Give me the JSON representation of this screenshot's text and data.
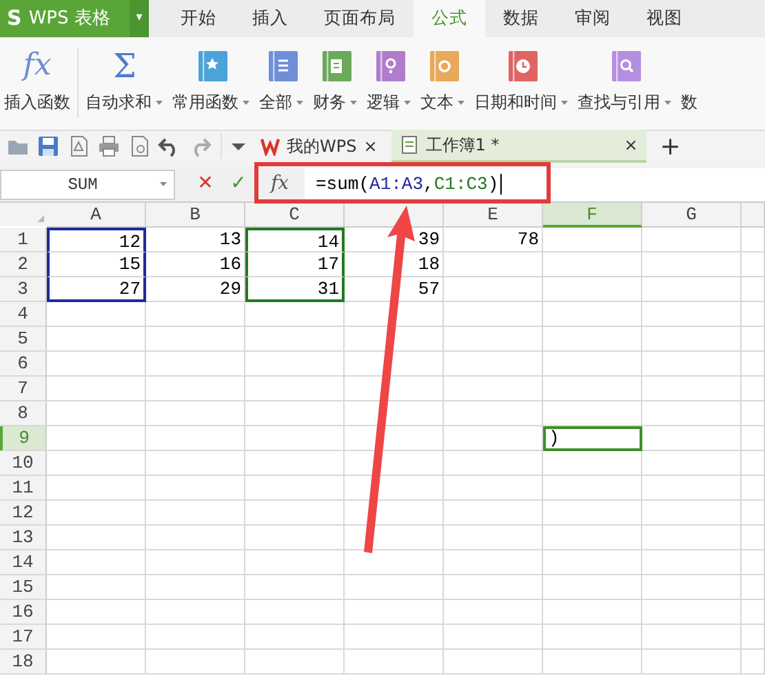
{
  "app": {
    "logo": "S",
    "title": "WPS 表格",
    "menu_caret": "▾"
  },
  "menu_tabs": [
    {
      "label": "开始",
      "selected": false
    },
    {
      "label": "插入",
      "selected": false
    },
    {
      "label": "页面布局",
      "selected": false
    },
    {
      "label": "公式",
      "selected": true
    },
    {
      "label": "数据",
      "selected": false
    },
    {
      "label": "审阅",
      "selected": false
    },
    {
      "label": "视图",
      "selected": false
    }
  ],
  "ribbon": [
    {
      "label": "插入函数",
      "kind": "glyph",
      "glyph": "fx",
      "dropdown": false
    },
    {
      "label": "自动求和",
      "kind": "glyph",
      "glyph": "Σ",
      "dropdown": true
    },
    {
      "label": "常用函数",
      "kind": "star",
      "color": "#4aa3d9",
      "dropdown": true
    },
    {
      "label": "全部",
      "kind": "lines",
      "color": "#6e8fd8",
      "dropdown": true
    },
    {
      "label": "财务",
      "kind": "doc",
      "color": "#6aaa5a",
      "dropdown": true
    },
    {
      "label": "逻辑",
      "kind": "dot",
      "color": "#b07ccc",
      "dropdown": true
    },
    {
      "label": "文本",
      "kind": "ring",
      "color": "#e9a85a",
      "dropdown": true
    },
    {
      "label": "日期和时间",
      "kind": "clock",
      "color": "#e06464",
      "dropdown": true
    },
    {
      "label": "查找与引用",
      "kind": "search",
      "color": "#b48ee0",
      "dropdown": true
    },
    {
      "label": "数",
      "kind": "text",
      "dropdown": false
    }
  ],
  "doc_tabs": [
    {
      "label": "我的WPS",
      "kind": "home",
      "close": "×",
      "selected": false
    },
    {
      "label": "工作簿1 *",
      "kind": "sheet",
      "close": "×",
      "selected": true
    }
  ],
  "new_tab": "+",
  "formula_bar": {
    "name_box": "SUM",
    "cancel": "✕",
    "confirm": "✓",
    "fx": "fx",
    "formula": [
      {
        "text": "=sum(",
        "color": "#000000"
      },
      {
        "text": "A1:A3",
        "color": "#1f2a9c"
      },
      {
        "text": ",",
        "color": "#000000"
      },
      {
        "text": "C1:C3",
        "color": "#217a21"
      },
      {
        "text": ")",
        "color": "#000000"
      }
    ]
  },
  "sheet": {
    "columns": [
      {
        "header": "A",
        "selected": false
      },
      {
        "header": "B",
        "selected": false
      },
      {
        "header": "C",
        "selected": false
      },
      {
        "selected": false
      },
      {
        "header": "E",
        "selected": false
      },
      {
        "header": "F",
        "selected": true
      },
      {
        "header": "G",
        "selected": false
      }
    ],
    "rows": [
      {
        "number": "1",
        "selected": false,
        "cells": [
          {
            "value": "12",
            "color": "#1f2a9c"
          },
          {
            "value": "13"
          },
          {
            "value": "14",
            "color": "#217a21"
          },
          {
            "value": "39"
          },
          {
            "value": "78"
          }
        ]
      },
      {
        "number": "2",
        "selected": false,
        "cells": [
          {
            "value": "15",
            "color": "#1f2a9c"
          },
          {
            "value": "16"
          },
          {
            "value": "17",
            "color": "#217a21"
          },
          {
            "value": "18"
          }
        ]
      },
      {
        "number": "3",
        "selected": false,
        "cells": [
          {
            "value": "27",
            "color": "#1f2a9c"
          },
          {
            "value": "29"
          },
          {
            "value": "31",
            "color": "#217a21"
          },
          {
            "value": "57"
          }
        ]
      },
      {
        "number": "4",
        "selected": false,
        "cells": []
      },
      {
        "number": "5",
        "selected": false,
        "cells": []
      },
      {
        "number": "6",
        "selected": false,
        "cells": []
      },
      {
        "number": "7",
        "selected": false,
        "cells": []
      },
      {
        "number": "8",
        "selected": false,
        "cells": []
      },
      {
        "number": "9",
        "selected": true,
        "cells": [
          null,
          null,
          null,
          null,
          null,
          {
            "value": ")",
            "active": true
          }
        ]
      },
      {
        "number": "10",
        "selected": false,
        "cells": []
      },
      {
        "number": "11",
        "selected": false,
        "cells": []
      },
      {
        "number": "12",
        "selected": false,
        "cells": []
      },
      {
        "number": "13",
        "selected": false,
        "cells": []
      },
      {
        "number": "14",
        "selected": false,
        "cells": []
      },
      {
        "number": "15",
        "selected": false,
        "cells": []
      },
      {
        "number": "16",
        "selected": false,
        "cells": []
      },
      {
        "number": "17",
        "selected": false,
        "cells": []
      },
      {
        "number": "18",
        "selected": false,
        "cells": []
      }
    ]
  }
}
